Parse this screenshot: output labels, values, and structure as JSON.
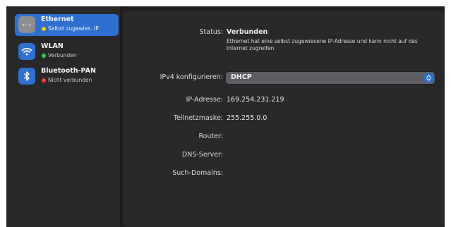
{
  "sidebar": {
    "items": [
      {
        "name": "Ethernet",
        "status": "Selbst zugewies. IP",
        "status_color": "#f5c518",
        "selected": true,
        "icon": "ethernet-icon"
      },
      {
        "name": "WLAN",
        "status": "Verbunden",
        "status_color": "#2ecc40",
        "selected": false,
        "icon": "wifi-icon"
      },
      {
        "name": "Bluetooth-PAN",
        "status": "Nicht verbunden",
        "status_color": "#ff3b30",
        "selected": false,
        "icon": "bluetooth-icon"
      }
    ]
  },
  "details": {
    "status_label": "Status:",
    "status_value": "Verbunden",
    "status_description": "Ethernet hat eine selbst zugewiesene IP-Adresse und kann nicht auf das Internet zugreifen.",
    "ipv4_label": "IPv4 konfigurieren:",
    "ipv4_value": "DHCP",
    "ip_label": "IP-Adresse:",
    "ip_value": "169.254.231.219",
    "subnet_label": "Teilnetzmaske:",
    "subnet_value": "255.255.0.0",
    "router_label": "Router:",
    "router_value": "",
    "dns_label": "DNS-Server:",
    "dns_value": "",
    "search_label": "Such-Domains:",
    "search_value": ""
  },
  "colors": {
    "accent": "#2f6fd0",
    "sidebar_bg": "#28282b",
    "panel_bg": "#29292b",
    "window_bg": "#1f1f21"
  }
}
